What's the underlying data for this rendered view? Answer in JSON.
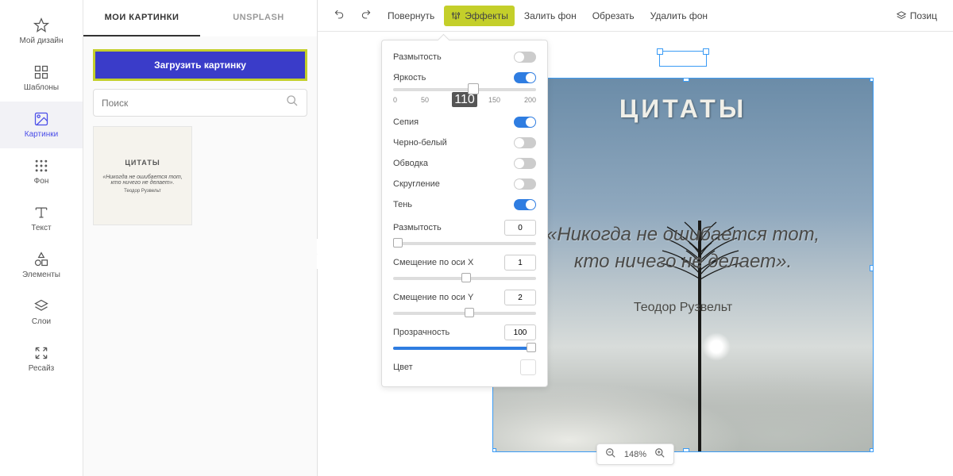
{
  "sidebar": {
    "items": [
      {
        "label": "Мой дизайн"
      },
      {
        "label": "Шаблоны"
      },
      {
        "label": "Картинки"
      },
      {
        "label": "Фон"
      },
      {
        "label": "Текст"
      },
      {
        "label": "Элементы"
      },
      {
        "label": "Слои"
      },
      {
        "label": "Ресайз"
      }
    ]
  },
  "leftpanel": {
    "tabs": [
      {
        "label": "МОИ КАРТИНКИ"
      },
      {
        "label": "UNSPLASH"
      }
    ],
    "upload_label": "Загрузить картинку",
    "search_placeholder": "Поиск",
    "thumb": {
      "title": "ЦИТАТЫ",
      "quote": "«Никогда не ошибается тот, кто ничего не делает».",
      "author": "Теодор Рузвельт"
    }
  },
  "toolbar": {
    "rotate": "Повернуть",
    "effects": "Эффекты",
    "fill_bg": "Залить фон",
    "crop": "Обрезать",
    "remove_bg": "Удалить фон",
    "position": "Позиц"
  },
  "effects": {
    "blur": "Размытость",
    "brightness": "Яркость",
    "brightness_value": "110",
    "ticks": [
      "0",
      "50",
      "100",
      "150",
      "200"
    ],
    "sepia": "Сепия",
    "bw": "Черно-белый",
    "stroke": "Обводка",
    "rounding": "Скругление",
    "shadow": "Тень",
    "shadow_blur": "Размытость",
    "shadow_blur_val": "0",
    "offset_x": "Смещение по оси X",
    "offset_x_val": "1",
    "offset_y": "Смещение по оси Y",
    "offset_y_val": "2",
    "opacity": "Прозрачность",
    "opacity_val": "100",
    "color": "Цвет"
  },
  "canvas_image": {
    "title": "ЦИТАТЫ",
    "quote_line1": "«Никогда не ошибается тот,",
    "quote_line2": "кто ничего не делает».",
    "author": "Теодор Рузвельт"
  },
  "zoom": {
    "value": "148%"
  }
}
